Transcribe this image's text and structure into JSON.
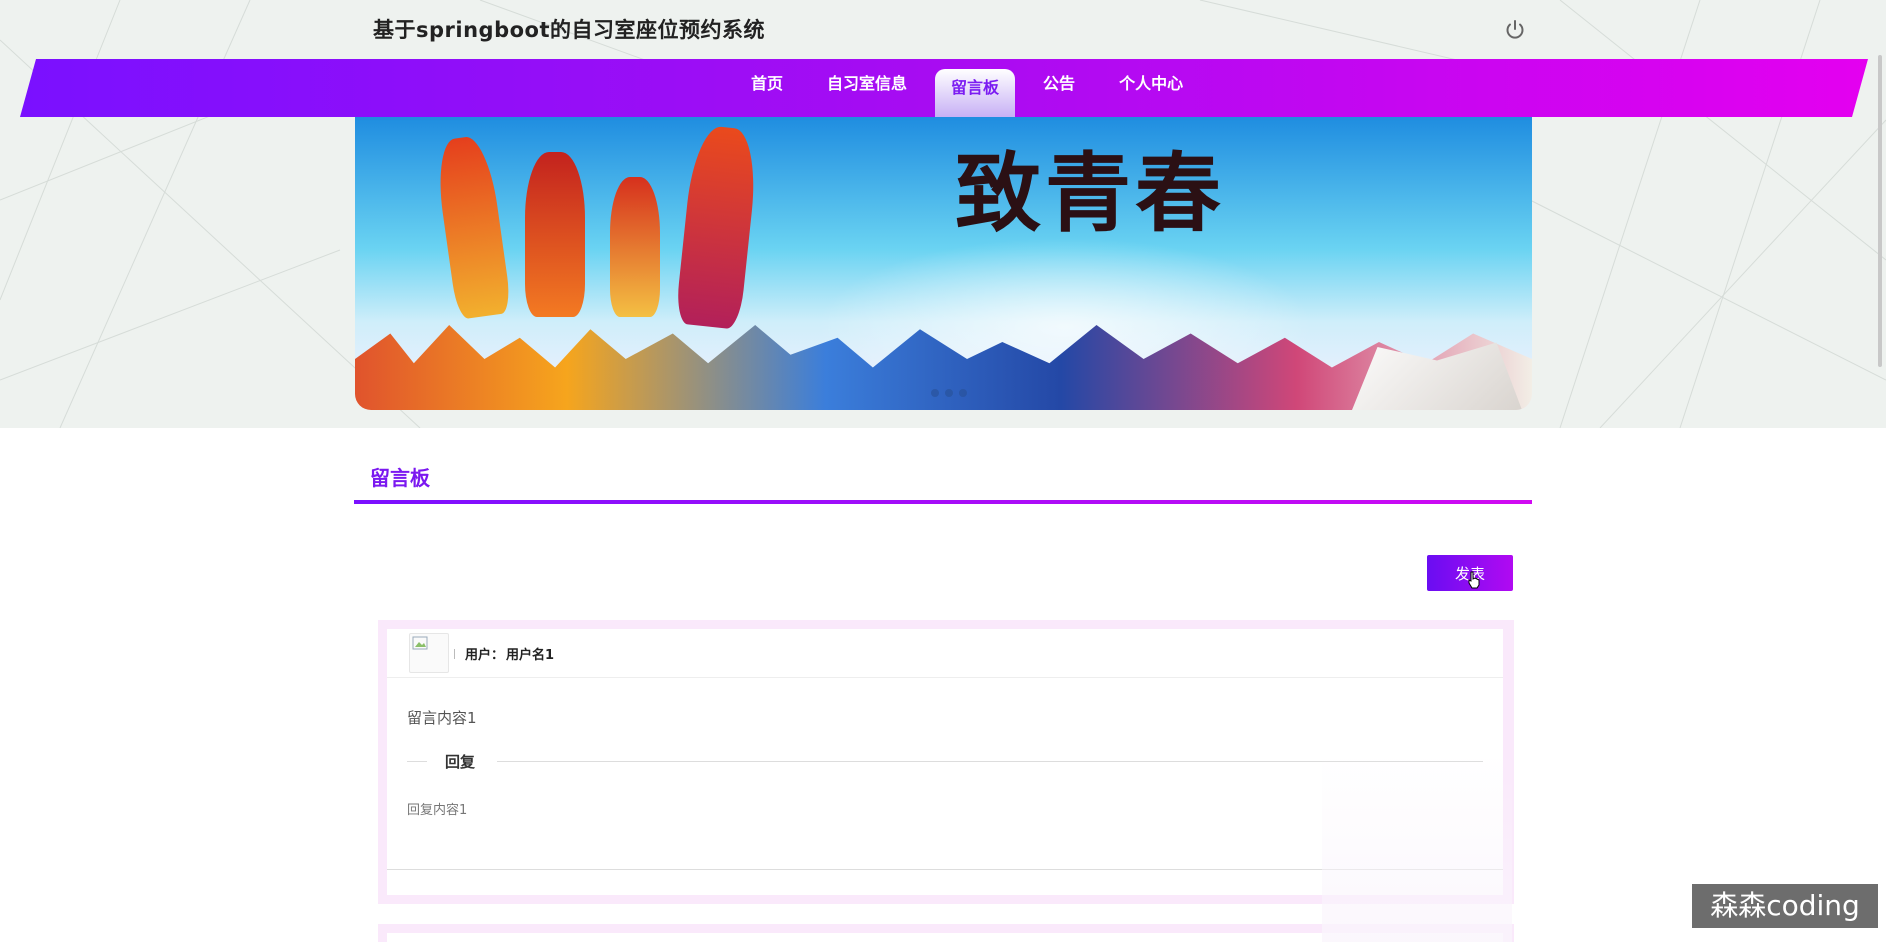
{
  "app": {
    "title": "基于springboot的自习室座位预约系统"
  },
  "nav": {
    "items": [
      {
        "label": "首页",
        "active": false
      },
      {
        "label": "自习室信息",
        "active": false
      },
      {
        "label": "留言板",
        "active": true
      },
      {
        "label": "公告",
        "active": false
      },
      {
        "label": "个人中心",
        "active": false
      }
    ]
  },
  "icons": {
    "power": "power-icon",
    "avatar": "avatar-placeholder-icon"
  },
  "banner": {
    "slogan": "致青春",
    "slides": 3
  },
  "section": {
    "title": "留言板",
    "publish_label": "发表"
  },
  "messages": [
    {
      "user_label": "用户：",
      "user_name": "用户名1",
      "content": "留言内容1",
      "reply_title": "回复",
      "reply_content": "回复内容1"
    }
  ],
  "watermark": "森森coding",
  "colors": {
    "accent_start": "#7a10ff",
    "accent_end": "#e400f0",
    "card_border": "#fae9fb"
  }
}
